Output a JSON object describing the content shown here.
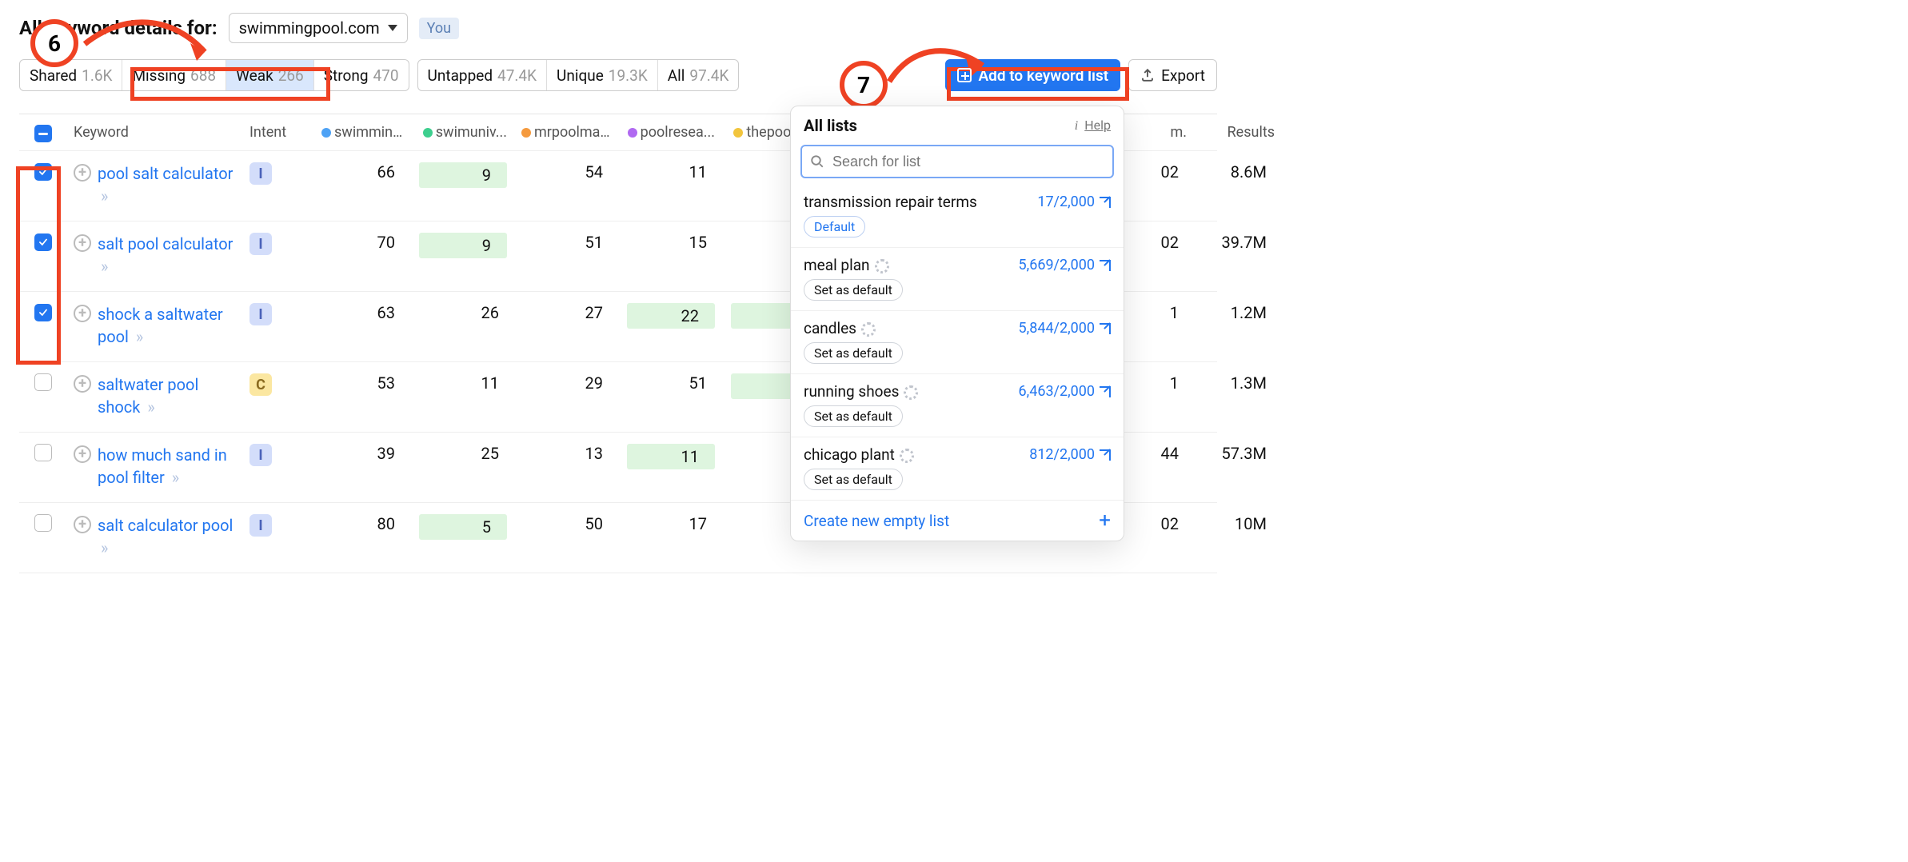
{
  "header": {
    "title": "All keyword details for:",
    "domain": "swimmingpool.com",
    "you_label": "You"
  },
  "tabs": [
    {
      "label": "Shared",
      "count": "1.6K"
    },
    {
      "label": "Missing",
      "count": "688"
    },
    {
      "label": "Weak",
      "count": "266",
      "active": true
    },
    {
      "label": "Strong",
      "count": "470"
    },
    {
      "label": "Untapped",
      "count": "47.4K"
    },
    {
      "label": "Unique",
      "count": "19.3K"
    },
    {
      "label": "All",
      "count": "97.4K"
    }
  ],
  "actions": {
    "add_label": "Add to keyword list",
    "export_label": "Export"
  },
  "columns": {
    "keyword": "Keyword",
    "intent": "Intent",
    "comp1": "swimming...",
    "comp2": "swimuniv...",
    "comp3": "mrpoolma...",
    "comp4": "poolresea...",
    "comp5": "thepoolfa...",
    "last_num": "m.",
    "results": "Results"
  },
  "dotColors": {
    "comp1": "#4ea2f5",
    "comp2": "#3dcf8e",
    "comp3": "#f59a3e",
    "comp4": "#b069f1",
    "comp5": "#f2c53d"
  },
  "rows": [
    {
      "checked": true,
      "keyword": "pool salt calculator",
      "intent": "I",
      "v1": "66",
      "v2": "9",
      "v3": "54",
      "v4": "11",
      "greenCol": 2,
      "greenCol2": null,
      "m": "02",
      "results": "8.6M"
    },
    {
      "checked": true,
      "keyword": "salt pool calculator",
      "intent": "I",
      "v1": "70",
      "v2": "9",
      "v3": "51",
      "v4": "15",
      "greenCol": 2,
      "greenCol2": null,
      "m": "02",
      "results": "39.7M"
    },
    {
      "checked": true,
      "keyword": "shock a saltwater pool",
      "intent": "I",
      "v1": "63",
      "v2": "26",
      "v3": "27",
      "v4": "22",
      "greenCol": 4,
      "greenCol2": 5,
      "m": "1",
      "results": "1.2M"
    },
    {
      "checked": false,
      "keyword": "saltwater pool shock",
      "intent": "C",
      "v1": "53",
      "v2": "11",
      "v3": "29",
      "v4": "51",
      "greenCol": 5,
      "greenCol2": null,
      "m": "1",
      "results": "1.3M"
    },
    {
      "checked": false,
      "keyword": "how much sand in pool filter",
      "intent": "I",
      "v1": "39",
      "v2": "25",
      "v3": "13",
      "v4": "11",
      "greenCol": 4,
      "greenCol2": null,
      "m": "44",
      "results": "57.3M"
    },
    {
      "checked": false,
      "keyword": "salt calculator pool",
      "intent": "I",
      "v1": "80",
      "v2": "5",
      "v3": "50",
      "v4": "17",
      "greenCol": 2,
      "greenCol2": null,
      "m": "02",
      "results": "10M"
    }
  ],
  "popover": {
    "title": "All lists",
    "help": "Help",
    "search_placeholder": "Search for list",
    "default_badge": "Default",
    "set_default_badge": "Set as default",
    "items": [
      {
        "name": "transmission repair terms",
        "count": "17/2,000",
        "default": true,
        "loop": false
      },
      {
        "name": "meal plan",
        "count": "5,669/2,000",
        "default": false,
        "loop": true
      },
      {
        "name": "candles",
        "count": "5,844/2,000",
        "default": false,
        "loop": true
      },
      {
        "name": "running shoes",
        "count": "6,463/2,000",
        "default": false,
        "loop": true
      },
      {
        "name": "chicago plant",
        "count": "812/2,000",
        "default": false,
        "loop": true
      }
    ],
    "footer": "Create new empty list"
  },
  "annotations": {
    "step6": "6",
    "step7": "7"
  }
}
